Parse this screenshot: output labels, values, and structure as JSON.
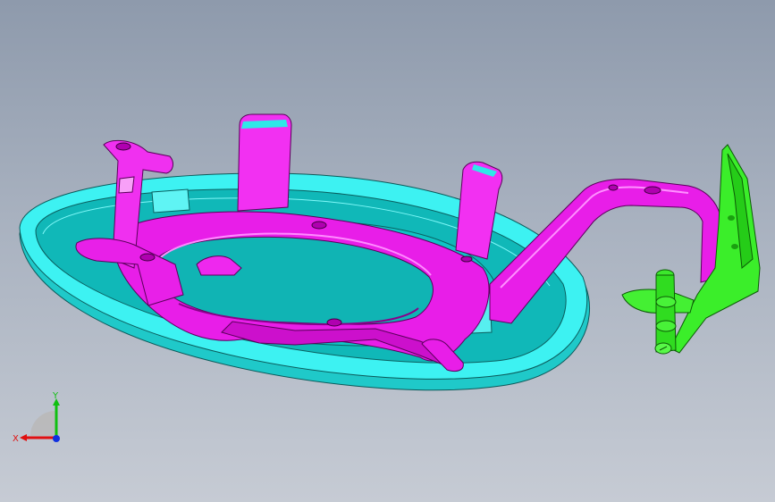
{
  "viewport": {
    "background_top": "#8e9aac",
    "background_bottom": "#c6cbd4"
  },
  "parts": [
    {
      "name": "cyan-elliptical-base-plate",
      "color": "#2ee8e8"
    },
    {
      "name": "magenta-bracket-frame",
      "color": "#f020f0"
    },
    {
      "name": "green-hinge-bracket",
      "color": "#33ee22"
    }
  ],
  "triad": {
    "x_label": "X",
    "y_label": "Y",
    "x_color": "#e01010",
    "y_color": "#10c010",
    "z_color": "#1030e0"
  }
}
